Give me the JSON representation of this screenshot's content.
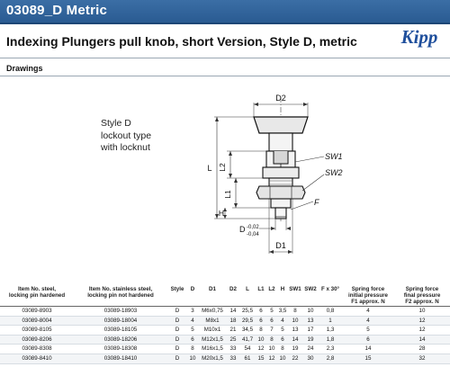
{
  "header": {
    "title": "03089_D Metric",
    "subtitle": "Indexing Plungers pull knob, short Version, Style D, metric",
    "logo_text": "Kipp"
  },
  "section": {
    "label": "Drawings"
  },
  "drawing": {
    "caption_lines": [
      "Style D",
      "lockout type",
      "with locknut"
    ],
    "labels": {
      "d2": "D2",
      "sw1": "SW1",
      "sw2": "SW2",
      "l": "L",
      "l2": "L2",
      "l1": "L1",
      "h": "H",
      "f": "F",
      "d": "D",
      "tol_upper": "-0,02",
      "tol_lower": "-0,04",
      "d1": "D1"
    }
  },
  "table": {
    "columns": [
      "Item No. steel,\nlocking pin hardened",
      "Item No. stainless steel,\nlocking pin not hardened",
      "Style",
      "D",
      "D1",
      "D2",
      "L",
      "L1",
      "L2",
      "H",
      "SW1",
      "SW2",
      "F x 30°",
      "Spring force\ninitial pressure\nF1 approx. N",
      "Spring force\nfinal pressure\nF2 approx. N"
    ],
    "rows": [
      [
        "03089-8903",
        "03089-18903",
        "D",
        "3",
        "M6x0,75",
        "14",
        "25,5",
        "6",
        "5",
        "3,5",
        "8",
        "10",
        "0,8",
        "4",
        "10"
      ],
      [
        "03089-8004",
        "03089-18004",
        "D",
        "4",
        "M8x1",
        "18",
        "29,5",
        "6",
        "6",
        "4",
        "10",
        "13",
        "1",
        "4",
        "12"
      ],
      [
        "03089-8105",
        "03089-18105",
        "D",
        "5",
        "M10x1",
        "21",
        "34,5",
        "8",
        "7",
        "5",
        "13",
        "17",
        "1,3",
        "5",
        "12"
      ],
      [
        "03089-8206",
        "03089-18206",
        "D",
        "6",
        "M12x1,5",
        "25",
        "41,7",
        "10",
        "8",
        "6",
        "14",
        "19",
        "1,8",
        "6",
        "14"
      ],
      [
        "03089-8308",
        "03089-18308",
        "D",
        "8",
        "M16x1,5",
        "33",
        "54",
        "12",
        "10",
        "8",
        "19",
        "24",
        "2,3",
        "14",
        "28"
      ],
      [
        "03089-8410",
        "03089-18410",
        "D",
        "10",
        "M20x1,5",
        "33",
        "61",
        "15",
        "12",
        "10",
        "22",
        "30",
        "2,8",
        "15",
        "32"
      ]
    ]
  }
}
